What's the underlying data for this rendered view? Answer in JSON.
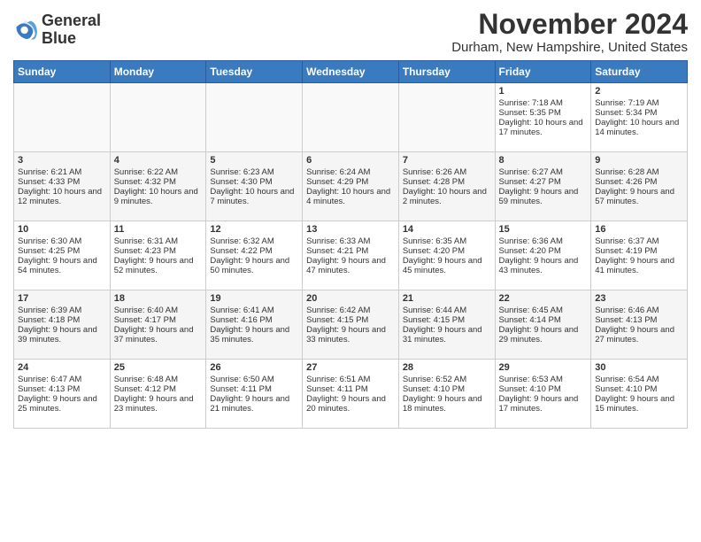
{
  "logo": {
    "line1": "General",
    "line2": "Blue"
  },
  "header": {
    "title": "November 2024",
    "subtitle": "Durham, New Hampshire, United States"
  },
  "days_of_week": [
    "Sunday",
    "Monday",
    "Tuesday",
    "Wednesday",
    "Thursday",
    "Friday",
    "Saturday"
  ],
  "weeks": [
    [
      {
        "day": "",
        "content": ""
      },
      {
        "day": "",
        "content": ""
      },
      {
        "day": "",
        "content": ""
      },
      {
        "day": "",
        "content": ""
      },
      {
        "day": "",
        "content": ""
      },
      {
        "day": "1",
        "content": "Sunrise: 7:18 AM\nSunset: 5:35 PM\nDaylight: 10 hours and 17 minutes."
      },
      {
        "day": "2",
        "content": "Sunrise: 7:19 AM\nSunset: 5:34 PM\nDaylight: 10 hours and 14 minutes."
      }
    ],
    [
      {
        "day": "3",
        "content": "Sunrise: 6:21 AM\nSunset: 4:33 PM\nDaylight: 10 hours and 12 minutes."
      },
      {
        "day": "4",
        "content": "Sunrise: 6:22 AM\nSunset: 4:32 PM\nDaylight: 10 hours and 9 minutes."
      },
      {
        "day": "5",
        "content": "Sunrise: 6:23 AM\nSunset: 4:30 PM\nDaylight: 10 hours and 7 minutes."
      },
      {
        "day": "6",
        "content": "Sunrise: 6:24 AM\nSunset: 4:29 PM\nDaylight: 10 hours and 4 minutes."
      },
      {
        "day": "7",
        "content": "Sunrise: 6:26 AM\nSunset: 4:28 PM\nDaylight: 10 hours and 2 minutes."
      },
      {
        "day": "8",
        "content": "Sunrise: 6:27 AM\nSunset: 4:27 PM\nDaylight: 9 hours and 59 minutes."
      },
      {
        "day": "9",
        "content": "Sunrise: 6:28 AM\nSunset: 4:26 PM\nDaylight: 9 hours and 57 minutes."
      }
    ],
    [
      {
        "day": "10",
        "content": "Sunrise: 6:30 AM\nSunset: 4:25 PM\nDaylight: 9 hours and 54 minutes."
      },
      {
        "day": "11",
        "content": "Sunrise: 6:31 AM\nSunset: 4:23 PM\nDaylight: 9 hours and 52 minutes."
      },
      {
        "day": "12",
        "content": "Sunrise: 6:32 AM\nSunset: 4:22 PM\nDaylight: 9 hours and 50 minutes."
      },
      {
        "day": "13",
        "content": "Sunrise: 6:33 AM\nSunset: 4:21 PM\nDaylight: 9 hours and 47 minutes."
      },
      {
        "day": "14",
        "content": "Sunrise: 6:35 AM\nSunset: 4:20 PM\nDaylight: 9 hours and 45 minutes."
      },
      {
        "day": "15",
        "content": "Sunrise: 6:36 AM\nSunset: 4:20 PM\nDaylight: 9 hours and 43 minutes."
      },
      {
        "day": "16",
        "content": "Sunrise: 6:37 AM\nSunset: 4:19 PM\nDaylight: 9 hours and 41 minutes."
      }
    ],
    [
      {
        "day": "17",
        "content": "Sunrise: 6:39 AM\nSunset: 4:18 PM\nDaylight: 9 hours and 39 minutes."
      },
      {
        "day": "18",
        "content": "Sunrise: 6:40 AM\nSunset: 4:17 PM\nDaylight: 9 hours and 37 minutes."
      },
      {
        "day": "19",
        "content": "Sunrise: 6:41 AM\nSunset: 4:16 PM\nDaylight: 9 hours and 35 minutes."
      },
      {
        "day": "20",
        "content": "Sunrise: 6:42 AM\nSunset: 4:15 PM\nDaylight: 9 hours and 33 minutes."
      },
      {
        "day": "21",
        "content": "Sunrise: 6:44 AM\nSunset: 4:15 PM\nDaylight: 9 hours and 31 minutes."
      },
      {
        "day": "22",
        "content": "Sunrise: 6:45 AM\nSunset: 4:14 PM\nDaylight: 9 hours and 29 minutes."
      },
      {
        "day": "23",
        "content": "Sunrise: 6:46 AM\nSunset: 4:13 PM\nDaylight: 9 hours and 27 minutes."
      }
    ],
    [
      {
        "day": "24",
        "content": "Sunrise: 6:47 AM\nSunset: 4:13 PM\nDaylight: 9 hours and 25 minutes."
      },
      {
        "day": "25",
        "content": "Sunrise: 6:48 AM\nSunset: 4:12 PM\nDaylight: 9 hours and 23 minutes."
      },
      {
        "day": "26",
        "content": "Sunrise: 6:50 AM\nSunset: 4:11 PM\nDaylight: 9 hours and 21 minutes."
      },
      {
        "day": "27",
        "content": "Sunrise: 6:51 AM\nSunset: 4:11 PM\nDaylight: 9 hours and 20 minutes."
      },
      {
        "day": "28",
        "content": "Sunrise: 6:52 AM\nSunset: 4:10 PM\nDaylight: 9 hours and 18 minutes."
      },
      {
        "day": "29",
        "content": "Sunrise: 6:53 AM\nSunset: 4:10 PM\nDaylight: 9 hours and 17 minutes."
      },
      {
        "day": "30",
        "content": "Sunrise: 6:54 AM\nSunset: 4:10 PM\nDaylight: 9 hours and 15 minutes."
      }
    ]
  ]
}
